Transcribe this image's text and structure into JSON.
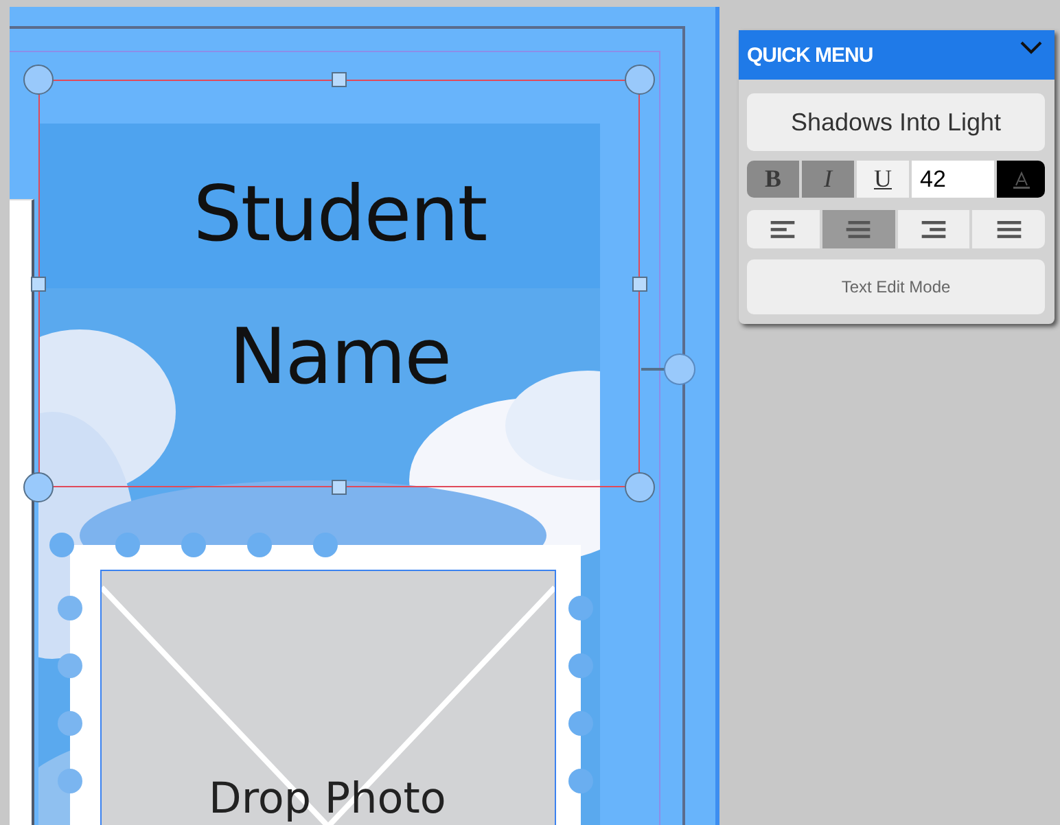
{
  "canvas": {
    "text_box": {
      "text": "Student Name",
      "selected": true
    },
    "photo_placeholder": {
      "label": "Drop Photo"
    }
  },
  "quick_menu": {
    "title": "QUICK MENU",
    "expanded": true,
    "font": "Shadows Into Light",
    "style_buttons": [
      {
        "label": "B",
        "kind": "bold",
        "disabled": true
      },
      {
        "label": "I",
        "kind": "italic",
        "disabled": true
      },
      {
        "label": "U",
        "kind": "underline",
        "disabled": false
      }
    ],
    "font_size": "42",
    "alignments": [
      {
        "kind": "left",
        "selected": false
      },
      {
        "kind": "center",
        "selected": true
      },
      {
        "kind": "right",
        "selected": false
      },
      {
        "kind": "justify",
        "selected": false
      }
    ],
    "mode_button": "Text Edit Mode"
  }
}
